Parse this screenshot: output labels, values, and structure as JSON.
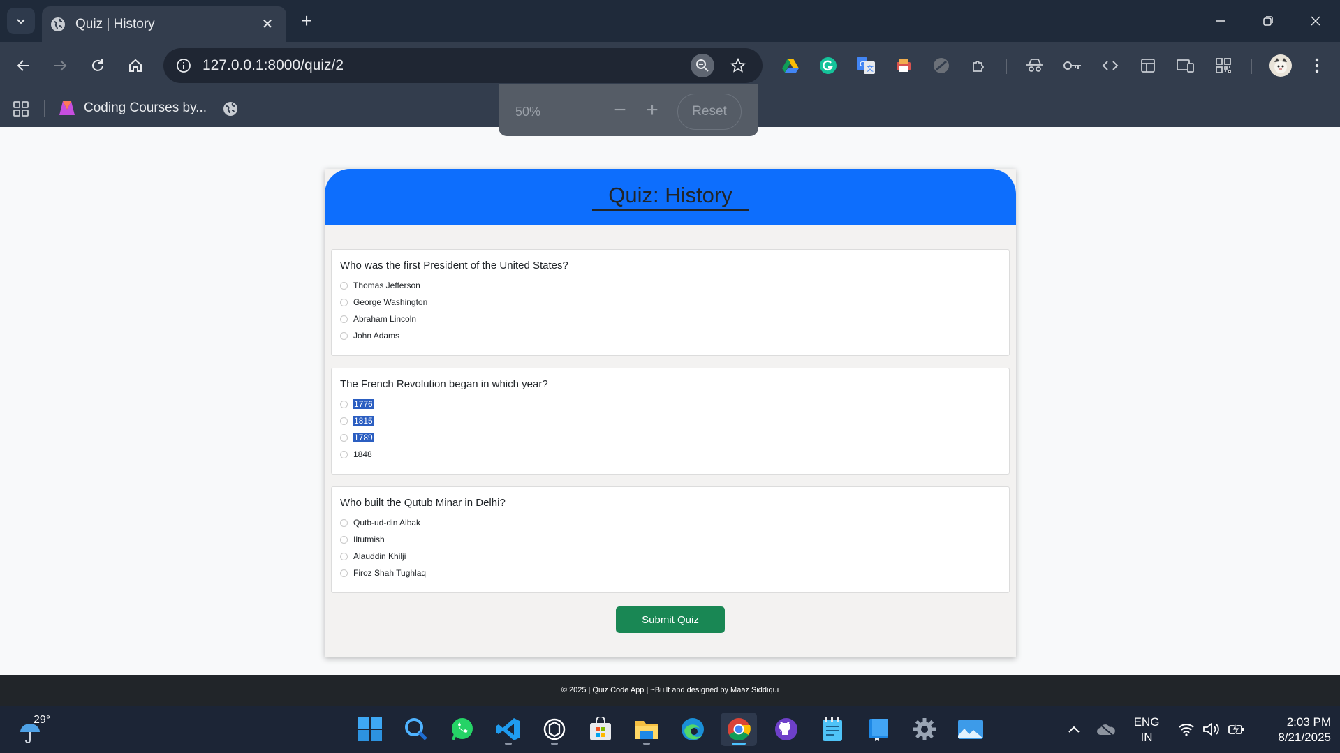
{
  "browser": {
    "tab_title": "Quiz | History",
    "url": "127.0.0.1:8000/quiz/2",
    "bookmark_label": "Coding Courses by...",
    "zoom_popup": {
      "percent": "50%",
      "minus": "−",
      "plus": "+",
      "reset": "Reset"
    },
    "new_tab": "+",
    "close_tab": "✕"
  },
  "quiz": {
    "title": "Quiz: History",
    "questions": [
      {
        "text": "Who was the first President of the United States?",
        "options": [
          "Thomas Jefferson",
          "George Washington",
          "Abraham Lincoln",
          "John Adams"
        ]
      },
      {
        "text": "The French Revolution began in which year?",
        "options": [
          "1776",
          "1815",
          "1789",
          "1848"
        ]
      },
      {
        "text": "Who built the Qutub Minar in Delhi?",
        "options": [
          "Qutb-ud-din Aibak",
          "Iltutmish",
          "Alauddin Khilji",
          "Firoz Shah Tughlaq"
        ]
      }
    ],
    "submit_label": "Submit Quiz"
  },
  "footer": {
    "text": "© 2025 | Quiz Code App | ~Built and designed by Maaz Siddiqui"
  },
  "taskbar": {
    "weather_temp": "29°",
    "lang_line1": "ENG",
    "lang_line2": "IN",
    "time": "2:03 PM",
    "date": "8/21/2025"
  },
  "colors": {
    "header_blue": "#0d6efd",
    "submit_green": "#198754",
    "selection_blue": "#2b5ec1",
    "footer_dark": "#212529"
  }
}
